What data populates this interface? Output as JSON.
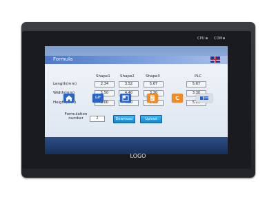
{
  "device": {
    "led_labels": [
      "CPU",
      "COM"
    ],
    "logo": "LOGO"
  },
  "window": {
    "title": "Formula"
  },
  "table": {
    "columns": [
      "Shape1",
      "Shape2",
      "Shape3",
      "PLC"
    ],
    "rows": [
      {
        "label": "Length(mm)",
        "values": [
          "2.34",
          "3.52",
          "5.67"
        ],
        "plc": "5.67"
      },
      {
        "label": "Width(mm)",
        "values": [
          "5.50",
          "4.40",
          "3.30"
        ],
        "plc": "3.30"
      },
      {
        "label": "Height(mm)",
        "values": [
          "3.00",
          "4.00",
          "5.00"
        ],
        "plc": "5.00"
      }
    ]
  },
  "formulation": {
    "label_line1": "Formulation",
    "label_line2": "number",
    "value": "2"
  },
  "buttons": {
    "download": "Download",
    "upload": "Upload"
  },
  "taskbar": {
    "gif_label": "GIF",
    "c_label": "C",
    "colors": {
      "home": "#2a64c8",
      "gif": "#2a64c8",
      "grid": "#2a64c8",
      "note": "#f08a24",
      "c": "#f08a24",
      "active": "#d8dde6"
    }
  }
}
